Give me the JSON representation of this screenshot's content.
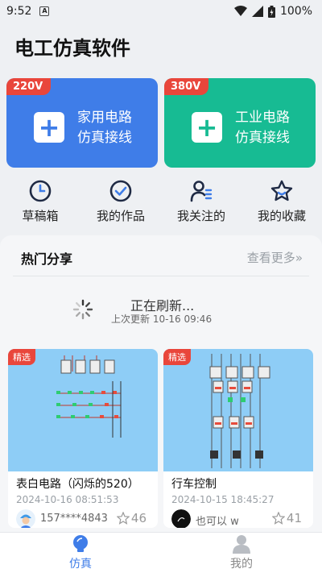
{
  "status": {
    "time": "9:52",
    "app_badge": "A",
    "battery": "100%"
  },
  "title": "电工仿真软件",
  "cards": [
    {
      "tag": "220V",
      "line1": "家用电路",
      "line2": "仿真接线",
      "color": "#3f7de8"
    },
    {
      "tag": "380V",
      "line1": "工业电路",
      "line2": "仿真接线",
      "color": "#17bb93"
    }
  ],
  "shortcuts": [
    {
      "label": "草稿箱",
      "icon": "clock-icon"
    },
    {
      "label": "我的作品",
      "icon": "check-circle-icon"
    },
    {
      "label": "我关注的",
      "icon": "user-list-icon"
    },
    {
      "label": "我的收藏",
      "icon": "star-icon"
    }
  ],
  "hot": {
    "title": "热门分享",
    "more": "查看更多",
    "more_icon": "»"
  },
  "refresh": {
    "status": "正在刷新...",
    "last": "上次更新 10-16 09:46"
  },
  "posts": [
    {
      "badge": "精选",
      "title": "表白电路（闪烁的520）",
      "date": "2024-10-16 08:51:53",
      "user": "157****4843",
      "stars": "46"
    },
    {
      "badge": "精选",
      "title": "行车控制",
      "date": "2024-10-15 18:45:27",
      "user": "也可以 w",
      "stars": "41"
    }
  ],
  "tabs": [
    {
      "label": "仿真",
      "icon": "bulb-icon",
      "active": true
    },
    {
      "label": "我的",
      "icon": "person-icon",
      "active": false
    }
  ],
  "colors": {
    "accent": "#3f7de8",
    "green": "#17bb93",
    "tag_red": "#e9463b"
  }
}
